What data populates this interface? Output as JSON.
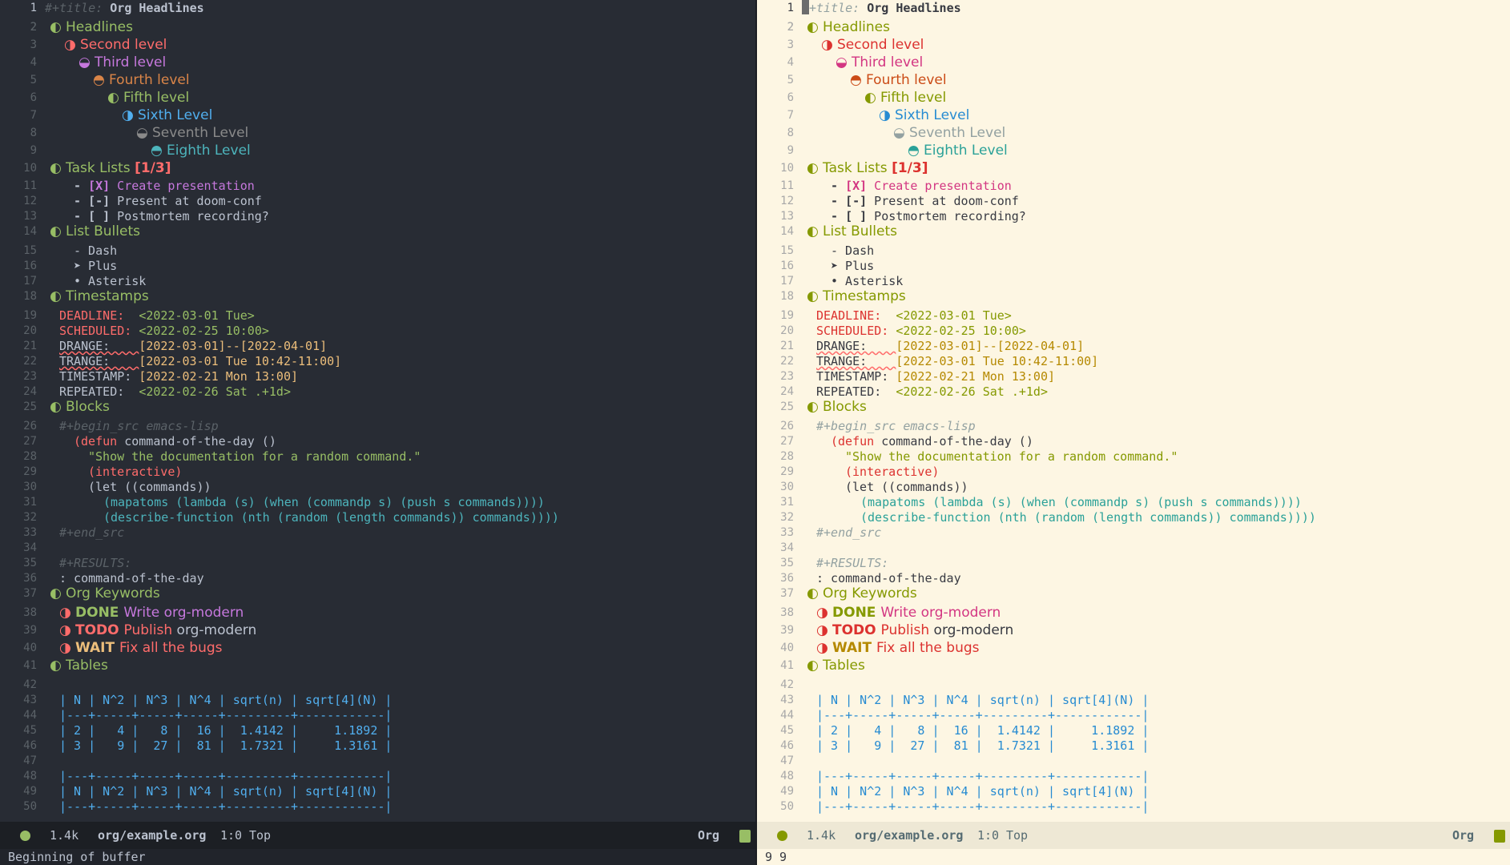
{
  "title_line": {
    "key": "#+title:",
    "value": "Org Headlines"
  },
  "headings": {
    "h1_headlines": "Headlines",
    "h2": "Second level",
    "h3": "Third level",
    "h4": "Fourth level",
    "h5": "Fifth level",
    "h6": "Sixth Level",
    "h7": "Seventh Level",
    "h8": "Eighth Level",
    "tasks": "Task Lists",
    "tasks_count": "[1/3]",
    "bullets": "List Bullets",
    "timestamps": "Timestamps",
    "blocks": "Blocks",
    "keywords": "Org Keywords",
    "tables": "Tables"
  },
  "tasks": [
    {
      "box": "[X]",
      "text": "Create presentation"
    },
    {
      "box": "[-]",
      "text": "Present at doom-conf"
    },
    {
      "box": "[ ]",
      "text": "Postmortem recording?"
    }
  ],
  "bullets": [
    "Dash",
    "Plus",
    "Asterisk"
  ],
  "bullet_marks": [
    "-",
    "➤",
    "•"
  ],
  "timestamps": [
    {
      "key": "DEADLINE:",
      "value": "<2022-03-01 Tue>"
    },
    {
      "key": "SCHEDULED:",
      "value": "<2022-02-25 10:00>"
    },
    {
      "key": "DRANGE:",
      "value": "[2022-03-01]--[2022-04-01]"
    },
    {
      "key": "TRANGE:",
      "value": "[2022-03-01 Tue 10:42-11:00]"
    },
    {
      "key": "TIMESTAMP:",
      "value": "[2022-02-21 Mon 13:00]"
    },
    {
      "key": "REPEATED:",
      "value": "<2022-02-26 Sat .+1d>"
    }
  ],
  "src": {
    "begin": "#+begin_src emacs-lisp",
    "l1": "(defun command-of-the-day ()",
    "l2": "\"Show the documentation for a random command.\"",
    "l3": "(interactive)",
    "l4": "(let ((commands))",
    "l5": "(mapatoms (lambda (s) (when (commandp s) (push s commands))))",
    "l6": "(describe-function (nth (random (length commands)) commands))))",
    "end": "#+end_src"
  },
  "results": {
    "key": "#+RESULTS:",
    "value": ": command-of-the-day"
  },
  "keywords": [
    {
      "kw": "DONE",
      "text": "Write org-modern"
    },
    {
      "kw": "TODO",
      "text": "Publish",
      "rest": "org-modern"
    },
    {
      "kw": "WAIT",
      "text": "Fix all the bugs"
    }
  ],
  "table": {
    "header": "| N | N^2 | N^3 | N^4 | sqrt(n) | sqrt[4](N) |",
    "sep": "|---+-----+-----+-----+---------+------------|",
    "row1": "| 2 |   4 |   8 |  16 |  1.4142 |     1.1892 |",
    "row2": "| 3 |   9 |  27 |  81 |  1.7321 |     1.3161 |"
  },
  "modeline": {
    "size": "1.4k",
    "path_dir": "org/",
    "path_file": "example.org",
    "pos": "1:0",
    "top": "Top",
    "mode": "Org"
  },
  "minibuffer_left": "Beginning of buffer",
  "minibuffer_right": "9 9",
  "line_numbers": [
    "1",
    "2",
    "3",
    "4",
    "5",
    "6",
    "7",
    "8",
    "9",
    "10",
    "11",
    "12",
    "13",
    "14",
    "15",
    "16",
    "17",
    "18",
    "19",
    "20",
    "21",
    "22",
    "23",
    "24",
    "25",
    "26",
    "27",
    "28",
    "29",
    "30",
    "31",
    "32",
    "33",
    "34",
    "35",
    "36",
    "37",
    "38",
    "39",
    "40",
    "41",
    "42",
    "43",
    "44",
    "45",
    "46",
    "47",
    "48",
    "49",
    "50"
  ]
}
